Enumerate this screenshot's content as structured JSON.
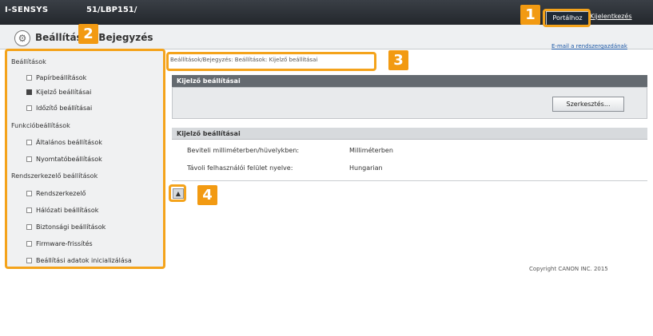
{
  "header": {
    "brand": "I-SENSYS",
    "model": "51/LBP151/",
    "portal_button": "Portálhoz",
    "logout_link": "Kijelentkezés"
  },
  "titlebar": {
    "title": "Beállítások/Bejegyzés",
    "email_link": "E-mail a rendszergazdának"
  },
  "sidebar": {
    "sections": [
      {
        "heading": "Beállítások",
        "items": [
          "Papírbeállítások",
          "Kijelző beállításai",
          "Időzítő beállításai"
        ]
      },
      {
        "heading": "Funkcióbeállítások",
        "items": [
          "Általános beállítások",
          "Nyomtatóbeállítások"
        ]
      },
      {
        "heading": "Rendszerkezelő beállítások",
        "items": [
          "Rendszerkezelő",
          "Hálózati beállítások",
          "Biztonsági beállítások",
          "Firmware-frissítés",
          "Beállítási adatok inicializálása"
        ]
      }
    ],
    "active_item": "Kijelző beállításai"
  },
  "main": {
    "breadcrumb": "Beállítások/Bejegyzés: Beállítások: Kijelző beállításai",
    "panel_title": "Kijelző beállításai",
    "edit_button": "Szerkesztés...",
    "section_title": "Kijelző beállításai",
    "rows": [
      {
        "label": "Beviteli milliméterben/hüvelykben:",
        "value": "Milliméterben"
      },
      {
        "label": "Távoli felhasználói felület nyelve:",
        "value": "Hungarian"
      }
    ],
    "up_icon": "up-arrow-icon"
  },
  "footer": {
    "copyright": "Copyright CANON INC. 2015"
  },
  "callouts": [
    "1",
    "2",
    "3",
    "4"
  ],
  "colors": {
    "callout": "#f29a12",
    "topbar": "#2b3036",
    "panel_header": "#646a70"
  }
}
